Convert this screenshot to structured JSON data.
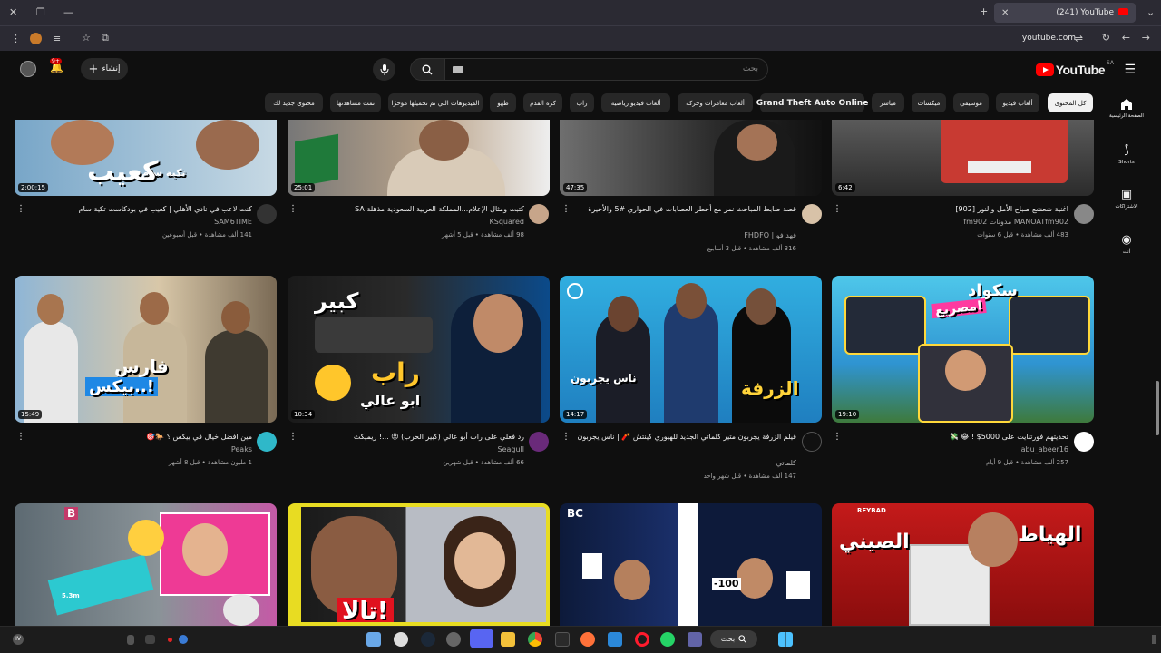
{
  "browser": {
    "tab_title": "(241) YouTube",
    "url": "youtube.com"
  },
  "header": {
    "logo_text": "YouTube",
    "country_code": "SA",
    "search_placeholder": "بحث",
    "create_label": "إنشاء",
    "notifications_badge": "9+"
  },
  "chips": [
    {
      "label": "كل المحتوى",
      "active": true
    },
    {
      "label": "ألعاب فيديو"
    },
    {
      "label": "موسيقى"
    },
    {
      "label": "ميكسات"
    },
    {
      "label": "مباشر"
    },
    {
      "label": "Grand Theft Auto Online"
    },
    {
      "label": "ألعاب مغامرات وحركة"
    },
    {
      "label": "ألعاب فيديو رياضية"
    },
    {
      "label": "راب"
    },
    {
      "label": "كرة القدم"
    },
    {
      "label": "طهو"
    },
    {
      "label": "الفيديوهات التي تم تحميلها مؤخرًا"
    },
    {
      "label": "تمت مشاهدتها"
    },
    {
      "label": "محتوى جديد لك"
    }
  ],
  "sidebar": [
    {
      "label": "الصفحة الرئيسية"
    },
    {
      "label": "Shorts"
    },
    {
      "label": "الاشتراكات"
    },
    {
      "label": "أنت"
    }
  ],
  "row1": [
    {
      "title": "اغنية شعشع صباح الأمل والنور [902]",
      "channel": "MANOATfm902 مدونات fm902",
      "meta": "483 ألف مشاهدة • قبل 6 سنوات",
      "duration": "6:42"
    },
    {
      "title": "قصة ضابط المباحث نمر مع أخطر العصابات في الحواري #5 والأخيرة",
      "channel": "فهد فو | FHDFO",
      "meta": "316 ألف مشاهدة • قبل 3 أسابيع",
      "duration": "47:35"
    },
    {
      "title": "كتبت ومثال الإعلام...المملكة العربية السعودية مذهلة SA",
      "channel": "KSquared",
      "meta": "98 ألف مشاهدة • قبل 5 أشهر",
      "duration": "25:01"
    },
    {
      "title": "كنت لاعب في نادي الأهلي | كعيب في بودكاست تكية سام",
      "channel": "SAM6TIME",
      "meta": "141 ألف مشاهدة • قبل أسبوعين",
      "duration": "2:00:15"
    }
  ],
  "row2": [
    {
      "title": "تحديتهم فورتنايت على 5000$ ! 😂 💸",
      "channel": "abu_abeer16",
      "meta": "257 ألف مشاهدة • قبل 9 أيام",
      "duration": "19:10"
    },
    {
      "title": "فيلم الزرفة يجربون متير كلماتي الجديد للهيوري كينتش 🧨 | ناس يجربون",
      "channel": "كلماتي",
      "meta": "147 ألف مشاهدة • قبل شهر واحد",
      "duration": "14:17"
    },
    {
      "title": "رد فعلي على راب أبو عالي (كبير الحرب) 😡 ...! ريميكث",
      "channel": "Seagull",
      "meta": "66 ألف مشاهدة • قبل شهرين",
      "duration": "10:34"
    },
    {
      "title": "مين افضل خيال في بيكس ؟ 🐎🎯",
      "channel": "Peaks",
      "meta": "1 مليون مشاهدة • قبل 8 أشهر",
      "duration": "15:49"
    }
  ],
  "thumb_text": {
    "r1c4_a": "تكية سام",
    "r1c4_b": "كعيب",
    "r2c1_a": "سكواد",
    "r2c1_b": "مصريع!",
    "r2c2_a": "الزرفة",
    "r2c2_b": "ناس يجربون",
    "r2c3_a": "راب",
    "r2c3_b": "ابو عالي",
    "r2c3_c": "كبير",
    "r2c4_a": "فارس",
    "r2c4_b": "بيكس..!",
    "r3c1_a": "الهياط",
    "r3c1_b": "الصيني",
    "r3c1_brand": "REYBAD",
    "r3c2_a": "BC",
    "r3c2_b": "-100",
    "r3c3_a": "تالا!",
    "r3c4_a": "5.3m",
    "r3c4_b": "B"
  },
  "taskbar": {
    "search_label": "بحث"
  }
}
